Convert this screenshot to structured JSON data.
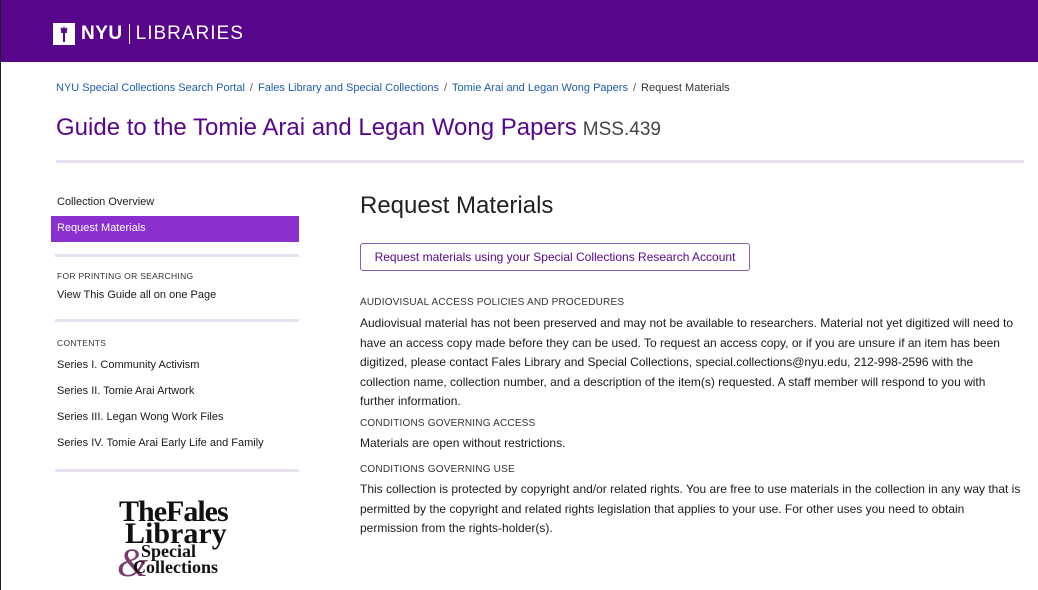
{
  "header": {
    "brand_nyu": "NYU",
    "brand_libraries": "LIBRARIES",
    "logo_icon": "nyu-torch-icon",
    "background_color": "#57068c"
  },
  "breadcrumb": {
    "items": [
      "NYU Special Collections Search Portal",
      "Fales Library and Special Collections",
      "Tomie Arai and Legan Wong Papers"
    ],
    "current": "Request Materials",
    "separator": "/"
  },
  "title": {
    "main": "Guide to the Tomie Arai and Legan Wong Papers",
    "id": "MSS.439"
  },
  "sidebar": {
    "nav": [
      {
        "label": "Collection Overview"
      },
      {
        "label": "Request Materials",
        "active": true
      }
    ],
    "printing_heading": "FOR PRINTING OR SEARCHING",
    "printing_link": "View This Guide all on one Page",
    "contents_heading": "CONTENTS",
    "contents": [
      "Series I. Community Activism",
      "Series II. Tomie Arai Artwork",
      "Series III. Legan Wong Work Files",
      "Series IV. Tomie Arai Early Life and Family"
    ],
    "active_color": "#8a30cf"
  },
  "logo": {
    "line1": "TheFales",
    "line2": "Library",
    "amp": "&",
    "line3": "Special",
    "line4": "Collections"
  },
  "content": {
    "heading": "Request Materials",
    "request_button": "Request materials using your Special Collections Research Account",
    "sections": [
      {
        "heading": "AUDIOVISUAL ACCESS POLICIES AND PROCEDURES",
        "body": "Audiovisual material has not been preserved and may not be available to researchers. Material not yet digitized will need to have an access copy made before they can be used. To request an access copy, or if you are unsure if an item has been digitized, please contact Fales Library and Special Collections, special.collections@nyu.edu, 212-998-2596 with the collection name, collection number, and a description of the item(s) requested. A staff member will respond to you with further information."
      },
      {
        "heading": "CONDITIONS GOVERNING ACCESS",
        "body": "Materials are open without restrictions."
      },
      {
        "heading": "CONDITIONS GOVERNING USE",
        "body": "This collection is protected by copyright and/or related rights. You are free to use materials in the collection in any way that is permitted by the copyright and related rights legislation that applies to your use. For other uses you need to obtain permission from the rights-holder(s)."
      }
    ]
  }
}
